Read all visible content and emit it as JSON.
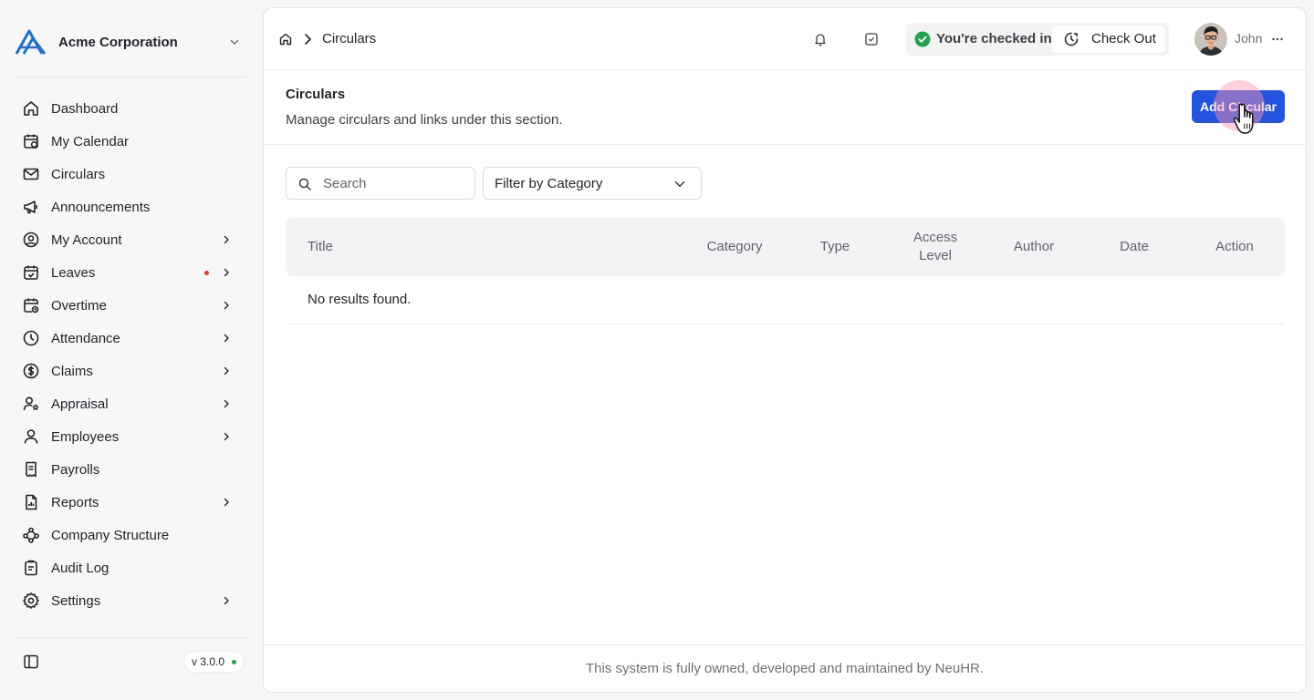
{
  "organization": {
    "name": "Acme Corporation"
  },
  "sidebar": {
    "items": [
      {
        "label": "Dashboard",
        "icon": "home-icon"
      },
      {
        "label": "My Calendar",
        "icon": "calendar-icon"
      },
      {
        "label": "Circulars",
        "icon": "mail-icon"
      },
      {
        "label": "Announcements",
        "icon": "megaphone-icon"
      },
      {
        "label": "My Account",
        "icon": "user-circle-icon",
        "expandable": true
      },
      {
        "label": "Leaves",
        "icon": "calendar-check-icon",
        "expandable": true,
        "notification": true
      },
      {
        "label": "Overtime",
        "icon": "calendar-clock-icon",
        "expandable": true
      },
      {
        "label": "Attendance",
        "icon": "clock-icon",
        "expandable": true
      },
      {
        "label": "Claims",
        "icon": "dollar-circle-icon",
        "expandable": true
      },
      {
        "label": "Appraisal",
        "icon": "user-star-icon",
        "expandable": true
      },
      {
        "label": "Employees",
        "icon": "user-icon",
        "expandable": true
      },
      {
        "label": "Payrolls",
        "icon": "receipt-icon"
      },
      {
        "label": "Reports",
        "icon": "file-chart-icon",
        "expandable": true
      },
      {
        "label": "Company Structure",
        "icon": "network-icon"
      },
      {
        "label": "Audit Log",
        "icon": "clipboard-icon"
      },
      {
        "label": "Settings",
        "icon": "gear-icon",
        "expandable": true
      }
    ],
    "version": "v 3.0.0"
  },
  "header": {
    "breadcrumb_current": "Circulars",
    "checkin_status": "You're checked in",
    "checkout_label": "Check Out",
    "user_name": "John"
  },
  "page": {
    "title": "Circulars",
    "subtitle": "Manage circulars and links under this section.",
    "add_button": "Add Circular"
  },
  "filters": {
    "search_placeholder": "Search",
    "category_label": "Filter by Category"
  },
  "table": {
    "columns": {
      "title": "Title",
      "category": "Category",
      "type": "Type",
      "access_level": "Access Level",
      "author": "Author",
      "date": "Date",
      "action": "Action"
    },
    "empty_message": "No results found."
  },
  "footer": {
    "text": "This system is fully owned, developed and maintained by NeuHR."
  },
  "colors": {
    "accent": "#2453e2",
    "success": "#22a34a",
    "notification": "#d9412f"
  }
}
